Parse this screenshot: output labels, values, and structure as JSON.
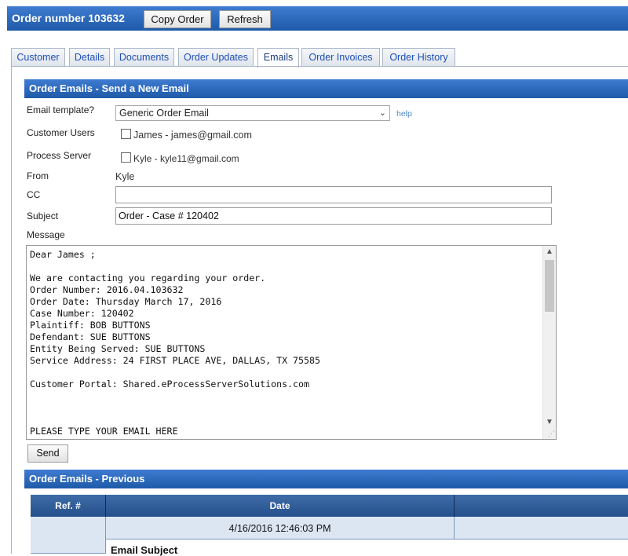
{
  "header": {
    "title": "Order number 103632",
    "copy_order": "Copy Order",
    "refresh": "Refresh"
  },
  "tabs": [
    {
      "label": "Customer",
      "active": false
    },
    {
      "label": "Details",
      "active": false
    },
    {
      "label": "Documents",
      "active": false
    },
    {
      "label": "Order Updates",
      "active": false
    },
    {
      "label": "Emails",
      "active": true
    },
    {
      "label": "Order Invoices",
      "active": false
    },
    {
      "label": "Order History",
      "active": false
    }
  ],
  "send_section": {
    "title": "Order Emails - Send a New Email",
    "template_label": "Email template?",
    "template_value": "Generic Order Email",
    "help": "help",
    "customer_users_label": "Customer Users",
    "customer_user": "James - james@gmail.com",
    "process_server_label": "Process Server",
    "process_server": "Kyle - kyle11@gmail.com",
    "from_label": "From",
    "from_value": "Kyle",
    "cc_label": "CC",
    "cc_value": "",
    "subject_label": "Subject",
    "subject_value": "Order - Case # 120402",
    "message_label": "Message",
    "message_body": "Dear James ;\n\nWe are contacting you regarding your order.\nOrder Number: 2016.04.103632\nOrder Date: Thursday March 17, 2016\nCase Number: 120402\nPlaintiff: BOB BUTTONS\nDefendant: SUE BUTTONS\nEntity Being Served: SUE BUTTONS\nService Address: 24 FIRST PLACE AVE, DALLAS, TX 75585\n\nCustomer Portal: Shared.eProcessServerSolutions.com\n\n\n\nPLEASE TYPE YOUR EMAIL HERE",
    "send": "Send"
  },
  "previous_section": {
    "title": "Order Emails - Previous",
    "columns": [
      "Ref. #",
      "Date",
      ""
    ],
    "rows": [
      {
        "ref": "",
        "date": "4/16/2016 12:46:03 PM",
        "subject_label": "Email Subject"
      }
    ]
  }
}
